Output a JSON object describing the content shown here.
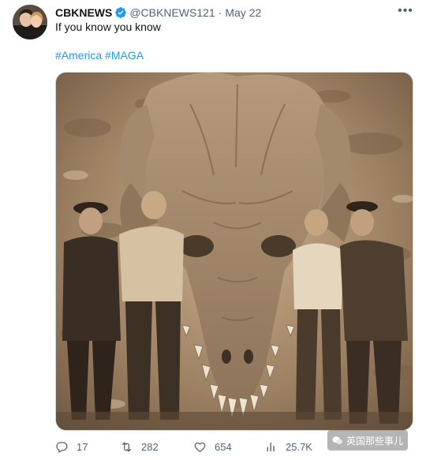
{
  "tweet": {
    "author_name": "CBKNEWS",
    "handle": "@CBKNEWS121",
    "separator": "·",
    "date": "May 22",
    "text": "If you know you know",
    "hashtags": [
      "#America",
      "#MAGA"
    ],
    "more_label": "•••"
  },
  "actions": {
    "replies": "17",
    "retweets": "282",
    "likes": "654",
    "views": "25.7K"
  },
  "watermark": {
    "text": "英国那些事儿"
  },
  "colors": {
    "accent": "#1d9bf0",
    "secondary_text": "#536471",
    "primary_text": "#0f1419"
  }
}
